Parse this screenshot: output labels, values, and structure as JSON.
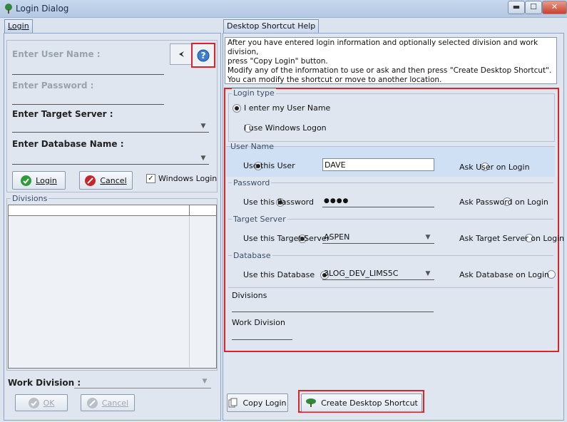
{
  "window": {
    "title": "Login Dialog",
    "controls": {
      "minimize": "▬",
      "maximize": "☐",
      "close": "✕"
    }
  },
  "login_tab": {
    "tab_label": "Login",
    "user_name_label": "Enter User Name :",
    "password_label": "Enter Password :",
    "target_server_label": "Enter Target Server :",
    "database_label": "Enter Database Name :",
    "login_button": "Login",
    "cancel_button": "Cancel",
    "windows_login_label": "Windows Login",
    "windows_login_checked": true,
    "divisions_group": "Divisions",
    "work_division_label": "Work Division :",
    "ok_button": "OK",
    "cancel2_button": "Cancel"
  },
  "help_tab": {
    "tab_label": "Desktop Shortcut Help",
    "help_text": [
      "After you have entered login information and optionally selected division and work division,",
      "press \"Copy Login\" button.",
      "Modify any of the information to use or ask and then press \"Create Desktop Shortcut\".",
      "You can modify the shortcut or move to another location."
    ],
    "login_type_group": "Login type",
    "login_type_options": [
      "I enter my User Name",
      "I use Windows Logon"
    ],
    "user_name_group": "User Name",
    "use_this_user": "Use this User",
    "user_value": "DAVE",
    "ask_user": "Ask User on Login",
    "password_group": "Password",
    "use_this_password": "Use this Password",
    "password_value": "●●●●",
    "ask_password": "Ask Password on Login",
    "target_server_group": "Target Server",
    "use_this_target_server": "Use this Target Server",
    "target_server_value": "ASPEN",
    "ask_target_server": "Ask Target Server on Login",
    "database_group": "Database",
    "use_this_database": "Use this Database",
    "database_value": "3LOG_DEV_LIMS5C",
    "ask_database": "Ask Database on Login",
    "divisions_label": "Divisions",
    "work_division_label": "Work Division",
    "copy_login_button": "Copy Login",
    "create_shortcut_button": "Create Desktop Shortcut"
  },
  "colors": {
    "highlight_red": "#d9252a",
    "selected_row": "#cfe0f4"
  }
}
